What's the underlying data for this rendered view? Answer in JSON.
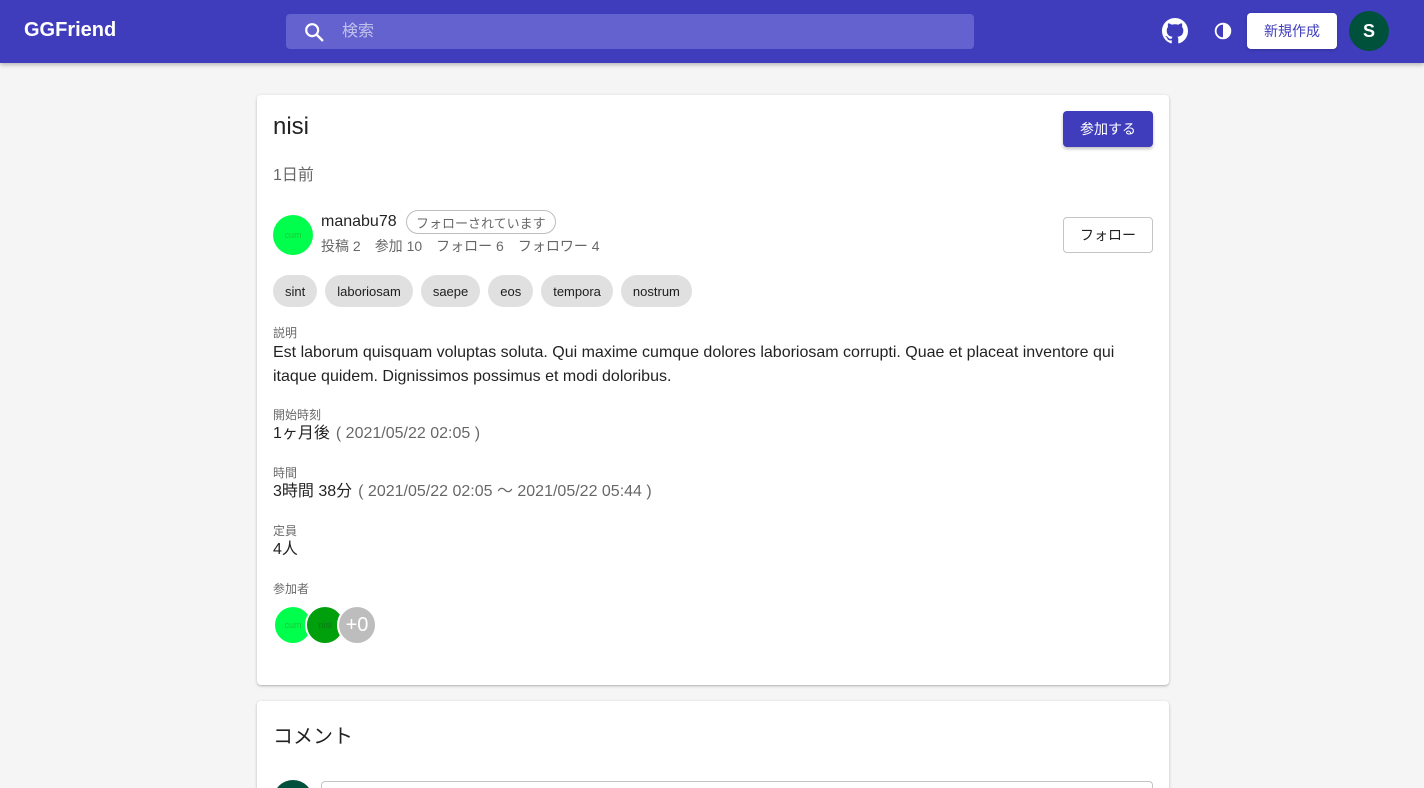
{
  "appbar": {
    "brand": "GGFriend",
    "search_placeholder": "検索",
    "new_button": "新規作成",
    "user_initial": "S"
  },
  "event": {
    "title": "nisi",
    "join_button": "参加する",
    "posted": "1日前",
    "owner": {
      "avatar_text": "cum",
      "name": "manabu78",
      "followed_badge": "フォローされています",
      "stats": [
        "投稿 2",
        "参加 10",
        "フォロー 6",
        "フォロワー 4"
      ],
      "follow_button": "フォロー"
    },
    "tags": [
      "sint",
      "laboriosam",
      "saepe",
      "eos",
      "tempora",
      "nostrum"
    ],
    "description_label": "説明",
    "description": "Est laborum quisquam voluptas soluta. Qui maxime cumque dolores laboriosam corrupti. Quae et placeat inventore qui itaque quidem. Dignissimos possimus et modi doloribus.",
    "start_label": "開始時刻",
    "start_relative": "1ヶ月後",
    "start_absolute": "( 2021/05/22 02:05 )",
    "duration_label": "時間",
    "duration": "3時間 38分",
    "duration_range": "( 2021/05/22 02:05 〜 2021/05/22 05:44 )",
    "capacity_label": "定員",
    "capacity": "4人",
    "participants_label": "参加者",
    "participants": [
      {
        "avatar_text": "cum",
        "color": "#00ff4c"
      },
      {
        "avatar_text": "nisi",
        "color": "#009f0c"
      }
    ],
    "participants_more": "+0"
  },
  "comments": {
    "title": "コメント"
  },
  "colors": {
    "primary": "#3f3dbc",
    "avatar_user": "#00513c"
  }
}
